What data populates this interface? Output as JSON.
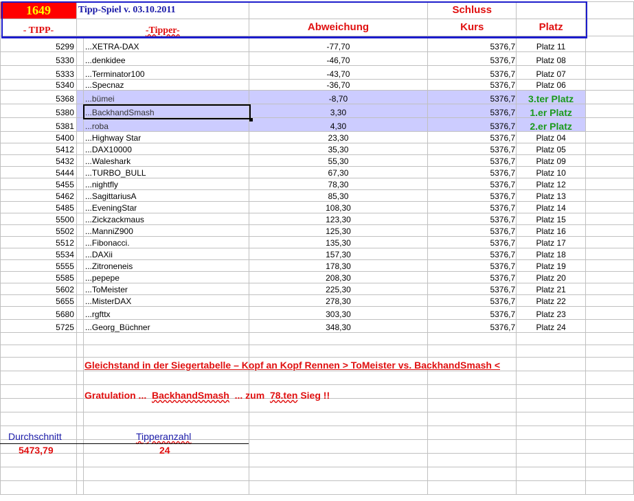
{
  "header": {
    "number": "1649",
    "title": "Tipp-Spiel v. 03.10.2011",
    "col_tipp": "- TIPP-",
    "col_tipper": "-Tipper-",
    "col_abweichung": "Abweichung",
    "col_schluss": "Schluss",
    "col_kurs": "Kurs",
    "col_platz": "Platz"
  },
  "rows": [
    {
      "tipp": "5299",
      "tipper": "...XETRA-DAX",
      "abw": "-77,70",
      "kurs": "5376,7",
      "platz": "Platz 11"
    },
    {
      "tipp": "5330",
      "tipper": "...denkidee",
      "abw": "-46,70",
      "kurs": "5376,7",
      "platz": "Platz 08"
    },
    {
      "tipp": "5333",
      "tipper": "...Terminator100",
      "abw": "-43,70",
      "kurs": "5376,7",
      "platz": "Platz 07"
    },
    {
      "tipp": "5340",
      "tipper": "...Specnaz",
      "abw": "-36,70",
      "kurs": "5376,7",
      "platz": "Platz 06"
    },
    {
      "tipp": "5368",
      "tipper": "...bümei",
      "abw": "-8,70",
      "kurs": "5376,7",
      "platz": "3.ter Platz",
      "highlight": true
    },
    {
      "tipp": "5380",
      "tipper": "...BackhandSmash",
      "abw": "3,30",
      "kurs": "5376,7",
      "platz": "1.er Platz",
      "highlight": true
    },
    {
      "tipp": "5381",
      "tipper": "...roba",
      "abw": "4,30",
      "kurs": "5376,7",
      "platz": "2.er Platz",
      "highlight": true
    },
    {
      "tipp": "5400",
      "tipper": "...Highway Star",
      "abw": "23,30",
      "kurs": "5376,7",
      "platz": "Platz 04"
    },
    {
      "tipp": "5412",
      "tipper": "...DAX10000",
      "abw": "35,30",
      "kurs": "5376,7",
      "platz": "Platz 05"
    },
    {
      "tipp": "5432",
      "tipper": "...Waleshark",
      "abw": "55,30",
      "kurs": "5376,7",
      "platz": "Platz 09"
    },
    {
      "tipp": "5444",
      "tipper": "...TURBO_BULL",
      "abw": "67,30",
      "kurs": "5376,7",
      "platz": "Platz 10"
    },
    {
      "tipp": "5455",
      "tipper": "...nightfly",
      "abw": "78,30",
      "kurs": "5376,7",
      "platz": "Platz 12"
    },
    {
      "tipp": "5462",
      "tipper": "...SagittariusA",
      "abw": "85,30",
      "kurs": "5376,7",
      "platz": "Platz 13"
    },
    {
      "tipp": "5485",
      "tipper": "...EveningStar",
      "abw": "108,30",
      "kurs": "5376,7",
      "platz": "Platz 14"
    },
    {
      "tipp": "5500",
      "tipper": "...Zickzackmaus",
      "abw": "123,30",
      "kurs": "5376,7",
      "platz": "Platz 15"
    },
    {
      "tipp": "5502",
      "tipper": "...ManniZ900",
      "abw": "125,30",
      "kurs": "5376,7",
      "platz": "Platz 16"
    },
    {
      "tipp": "5512",
      "tipper": "...Fibonacci.",
      "abw": "135,30",
      "kurs": "5376,7",
      "platz": "Platz 17"
    },
    {
      "tipp": "5534",
      "tipper": "...DAXii",
      "abw": "157,30",
      "kurs": "5376,7",
      "platz": "Platz 18"
    },
    {
      "tipp": "5555",
      "tipper": "...Zitroneneis",
      "abw": "178,30",
      "kurs": "5376,7",
      "platz": "Platz 19"
    },
    {
      "tipp": "5585",
      "tipper": "...pepepe",
      "abw": "208,30",
      "kurs": "5376,7",
      "platz": "Platz 20"
    },
    {
      "tipp": "5602",
      "tipper": "...ToMeister",
      "abw": "225,30",
      "kurs": "5376,7",
      "platz": "Platz 21"
    },
    {
      "tipp": "5655",
      "tipper": "...MisterDAX",
      "abw": "278,30",
      "kurs": "5376,7",
      "platz": "Platz 22"
    },
    {
      "tipp": "5680",
      "tipper": "...rgfttx",
      "abw": "303,30",
      "kurs": "5376,7",
      "platz": "Platz 23"
    },
    {
      "tipp": "5725",
      "tipper": "...Georg_Büchner",
      "abw": "348,30",
      "kurs": "5376,7",
      "platz": "Platz 24"
    }
  ],
  "notes": {
    "gleichstand": "Gleichstand in der Siegertabelle – Kopf an Kopf Rennen > ToMeister vs. BackhandSmash <",
    "gratulation_pre": "Gratulation ...  ",
    "gratulation_name": "BackhandSmash",
    "gratulation_mid": "  ... zum  ",
    "gratulation_count": "78.ten",
    "gratulation_post": " Sieg !!"
  },
  "summary": {
    "durchschnitt_label": "Durchschnitt",
    "durchschnitt_value": "5473,79",
    "tipperanzahl_label": "Tipperanzahl",
    "tipperanzahl_value": "24"
  }
}
